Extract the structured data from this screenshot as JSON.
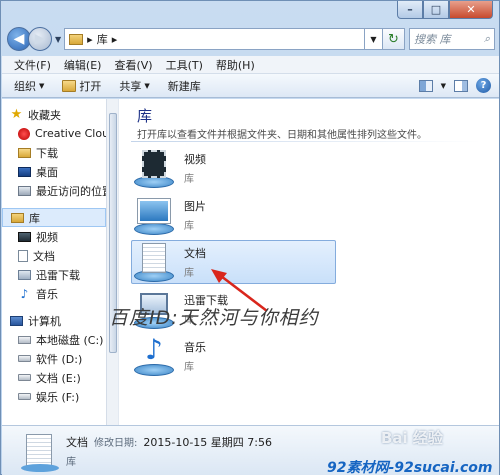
{
  "window": {
    "controls": {
      "minimize": "–",
      "maximize": "□",
      "close": "✕"
    }
  },
  "address": {
    "path_segments": [
      "库"
    ],
    "separator": "▸",
    "search_placeholder": "搜索 库"
  },
  "menu": [
    "文件(F)",
    "编辑(E)",
    "查看(V)",
    "工具(T)",
    "帮助(H)"
  ],
  "toolbar": {
    "organize": "组织",
    "open": "打开",
    "share": "共享",
    "new_library": "新建库"
  },
  "nav": {
    "favorites": {
      "label": "收藏夹",
      "items": [
        "Creative Cloud",
        "下载",
        "桌面",
        "最近访问的位置"
      ]
    },
    "libraries": {
      "label": "库",
      "items": [
        "视频",
        "文档",
        "迅雷下载",
        "音乐"
      ]
    },
    "computer": {
      "label": "计算机",
      "items": [
        "本地磁盘 (C:)",
        "软件 (D:)",
        "文档 (E:)",
        "娱乐 (F:)"
      ]
    }
  },
  "main": {
    "title": "库",
    "description": "打开库以查看文件并根据文件夹、日期和其他属性排列这些文件。",
    "items": [
      {
        "name": "视频",
        "sub": "库",
        "icon": "video-library-icon"
      },
      {
        "name": "图片",
        "sub": "库",
        "icon": "picture-library-icon"
      },
      {
        "name": "文档",
        "sub": "库",
        "icon": "document-library-icon",
        "selected": true
      },
      {
        "name": "迅雷下载",
        "sub": "库",
        "icon": "download-library-icon"
      },
      {
        "name": "音乐",
        "sub": "库",
        "icon": "music-library-icon"
      }
    ]
  },
  "details": {
    "name": "文档",
    "modified_label": "修改日期:",
    "modified_value": "2015-10-15 星期四 7:56",
    "type": "库"
  },
  "watermarks": {
    "author": "百度ID:天然河与你相约",
    "baidu": "Bai 经验",
    "site": "92素材网-92sucai.com"
  },
  "colors": {
    "accent": "#1e3287",
    "selection": "#c9e0fa",
    "arrow": "#d9261c"
  }
}
